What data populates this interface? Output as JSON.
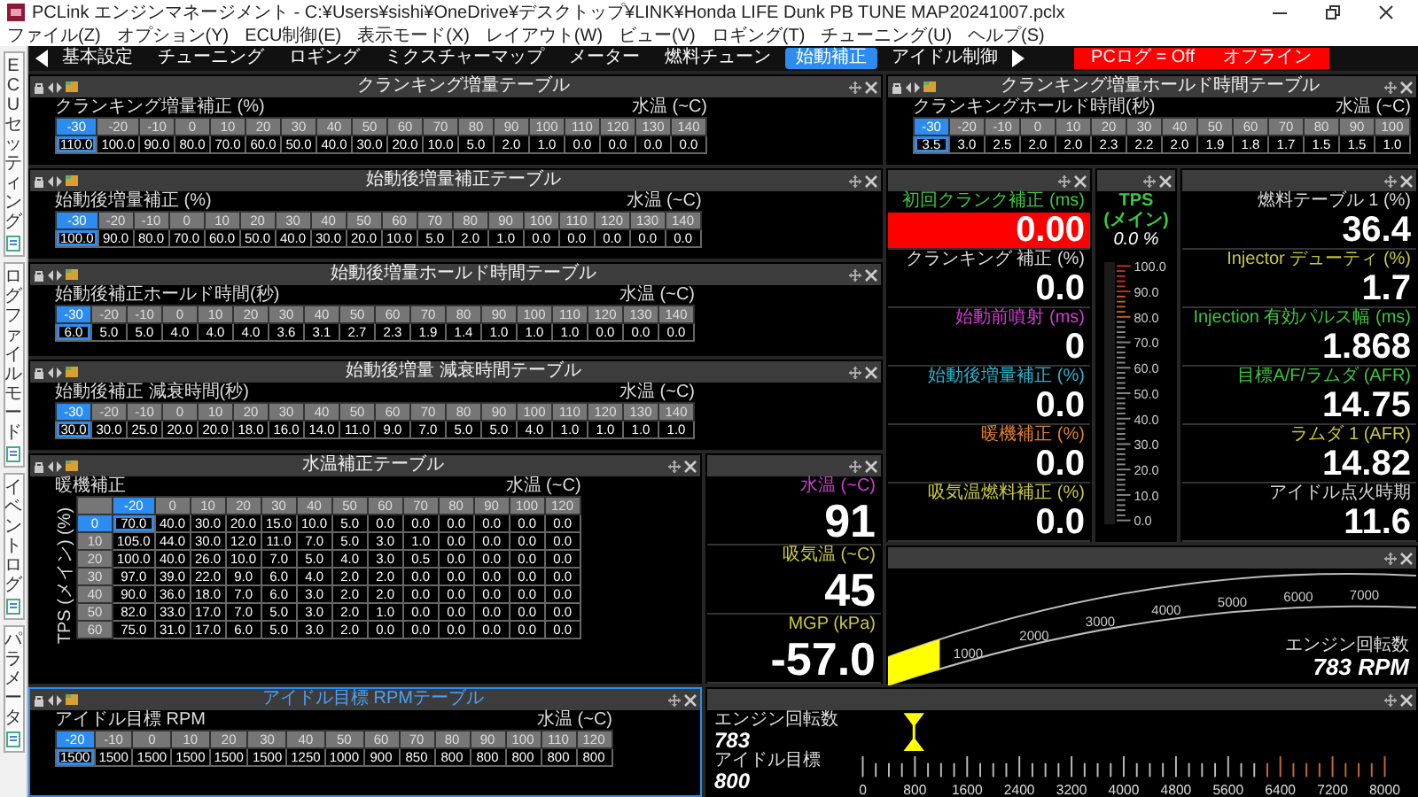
{
  "window": {
    "title": "PCLink エンジンマネージメント - C:¥Users¥sishi¥OneDrive¥デスクトップ¥LINK¥Honda LIFE Dunk PB TUNE MAP20241007.pclx"
  },
  "menu": [
    "ファイル(Z)",
    "オプション(Y)",
    "ECU制御(E)",
    "表示モード(X)",
    "レイアウト(W)",
    "ビュー(V)",
    "ロギング(T)",
    "チューニング(U)",
    "ヘルプ(S)"
  ],
  "sidebar": {
    "items": [
      {
        "label": "ECUセッティング"
      },
      {
        "label": "ログファイルモード"
      },
      {
        "label": "イベントログ"
      },
      {
        "label": "パラメータ"
      }
    ]
  },
  "tabs": [
    {
      "label": "基本設定",
      "selected": false
    },
    {
      "label": "チューニング",
      "selected": false
    },
    {
      "label": "ロギング",
      "selected": false
    },
    {
      "label": "ミクスチャーマップ",
      "selected": false
    },
    {
      "label": "メーター",
      "selected": false
    },
    {
      "label": "燃料チューン",
      "selected": false
    },
    {
      "label": "始動補正",
      "selected": true
    },
    {
      "label": "アイドル制御",
      "selected": false
    }
  ],
  "status": [
    "PCログ = Off",
    "オフライン"
  ],
  "tables": [
    {
      "kind": "row",
      "title": "クランキング増量テーブル",
      "focused": false,
      "axis_label": "クランキング増量補正 (%)",
      "unit": "水温 (~C)",
      "columns": [
        {
          "label": "-30",
          "selected": true
        },
        {
          "label": "-20",
          "selected": false
        },
        {
          "label": "-10",
          "selected": false
        },
        {
          "label": "0",
          "selected": false
        },
        {
          "label": "10",
          "selected": false
        },
        {
          "label": "20",
          "selected": false
        },
        {
          "label": "30",
          "selected": false
        },
        {
          "label": "40",
          "selected": false
        },
        {
          "label": "50",
          "selected": false
        },
        {
          "label": "60",
          "selected": false
        },
        {
          "label": "70",
          "selected": false
        },
        {
          "label": "80",
          "selected": false
        },
        {
          "label": "90",
          "selected": false
        },
        {
          "label": "100",
          "selected": false
        },
        {
          "label": "110",
          "selected": false
        },
        {
          "label": "120",
          "selected": false
        },
        {
          "label": "130",
          "selected": false
        },
        {
          "label": "140",
          "selected": false
        }
      ],
      "values": [
        "110.0",
        "100.0",
        "90.0",
        "80.0",
        "70.0",
        "60.0",
        "50.0",
        "40.0",
        "30.0",
        "20.0",
        "10.0",
        "5.0",
        "2.0",
        "1.0",
        "0.0",
        "0.0",
        "0.0",
        "0.0"
      ]
    },
    {
      "kind": "row",
      "title": "クランキング増量ホールド時間テーブル",
      "focused": false,
      "axis_label": "クランキングホールド時間(秒)",
      "unit": "水温 (~C)",
      "columns": [
        {
          "label": "-30",
          "selected": true
        },
        {
          "label": "-20",
          "selected": false
        },
        {
          "label": "-10",
          "selected": false
        },
        {
          "label": "0",
          "selected": false
        },
        {
          "label": "10",
          "selected": false
        },
        {
          "label": "20",
          "selected": false
        },
        {
          "label": "30",
          "selected": false
        },
        {
          "label": "40",
          "selected": false
        },
        {
          "label": "50",
          "selected": false
        },
        {
          "label": "60",
          "selected": false
        },
        {
          "label": "70",
          "selected": false
        },
        {
          "label": "80",
          "selected": false
        },
        {
          "label": "90",
          "selected": false
        },
        {
          "label": "100",
          "selected": false
        }
      ],
      "values": [
        "3.5",
        "3.0",
        "2.5",
        "2.0",
        "2.0",
        "2.3",
        "2.2",
        "2.0",
        "1.9",
        "1.8",
        "1.7",
        "1.5",
        "1.5",
        "1.0"
      ]
    },
    {
      "kind": "row",
      "title": "始動後増量補正テーブル",
      "focused": false,
      "axis_label": "始動後増量補正 (%)",
      "unit": "水温 (~C)",
      "columns": [
        {
          "label": "-30",
          "selected": true
        },
        {
          "label": "-20",
          "selected": false
        },
        {
          "label": "-10",
          "selected": false
        },
        {
          "label": "0",
          "selected": false
        },
        {
          "label": "10",
          "selected": false
        },
        {
          "label": "20",
          "selected": false
        },
        {
          "label": "30",
          "selected": false
        },
        {
          "label": "40",
          "selected": false
        },
        {
          "label": "50",
          "selected": false
        },
        {
          "label": "60",
          "selected": false
        },
        {
          "label": "70",
          "selected": false
        },
        {
          "label": "80",
          "selected": false
        },
        {
          "label": "90",
          "selected": false
        },
        {
          "label": "100",
          "selected": false
        },
        {
          "label": "110",
          "selected": false
        },
        {
          "label": "120",
          "selected": false
        },
        {
          "label": "130",
          "selected": false
        },
        {
          "label": "140",
          "selected": false
        }
      ],
      "values": [
        "100.0",
        "90.0",
        "80.0",
        "70.0",
        "60.0",
        "50.0",
        "40.0",
        "30.0",
        "20.0",
        "10.0",
        "5.0",
        "2.0",
        "1.0",
        "0.0",
        "0.0",
        "0.0",
        "0.0",
        "0.0"
      ]
    },
    {
      "kind": "row",
      "title": "始動後増量ホールド時間テーブル",
      "focused": false,
      "axis_label": "始動後補正ホールド時間(秒)",
      "unit": "水温 (~C)",
      "columns": [
        {
          "label": "-30",
          "selected": true
        },
        {
          "label": "-20",
          "selected": false
        },
        {
          "label": "-10",
          "selected": false
        },
        {
          "label": "0",
          "selected": false
        },
        {
          "label": "10",
          "selected": false
        },
        {
          "label": "20",
          "selected": false
        },
        {
          "label": "30",
          "selected": false
        },
        {
          "label": "40",
          "selected": false
        },
        {
          "label": "50",
          "selected": false
        },
        {
          "label": "60",
          "selected": false
        },
        {
          "label": "70",
          "selected": false
        },
        {
          "label": "80",
          "selected": false
        },
        {
          "label": "90",
          "selected": false
        },
        {
          "label": "100",
          "selected": false
        },
        {
          "label": "110",
          "selected": false
        },
        {
          "label": "120",
          "selected": false
        },
        {
          "label": "130",
          "selected": false
        },
        {
          "label": "140",
          "selected": false
        }
      ],
      "values": [
        "6.0",
        "5.0",
        "5.0",
        "4.0",
        "4.0",
        "4.0",
        "3.6",
        "3.1",
        "2.7",
        "2.3",
        "1.9",
        "1.4",
        "1.0",
        "1.0",
        "1.0",
        "0.0",
        "0.0",
        "0.0"
      ]
    },
    {
      "kind": "row",
      "title": "始動後増量 減衰時間テーブル",
      "focused": false,
      "axis_label": "始動後補正 減衰時間(秒)",
      "unit": "水温 (~C)",
      "columns": [
        {
          "label": "-30",
          "selected": true
        },
        {
          "label": "-20",
          "selected": false
        },
        {
          "label": "-10",
          "selected": false
        },
        {
          "label": "0",
          "selected": false
        },
        {
          "label": "10",
          "selected": false
        },
        {
          "label": "20",
          "selected": false
        },
        {
          "label": "30",
          "selected": false
        },
        {
          "label": "40",
          "selected": false
        },
        {
          "label": "50",
          "selected": false
        },
        {
          "label": "60",
          "selected": false
        },
        {
          "label": "70",
          "selected": false
        },
        {
          "label": "80",
          "selected": false
        },
        {
          "label": "90",
          "selected": false
        },
        {
          "label": "100",
          "selected": false
        },
        {
          "label": "110",
          "selected": false
        },
        {
          "label": "120",
          "selected": false
        },
        {
          "label": "130",
          "selected": false
        },
        {
          "label": "140",
          "selected": false
        }
      ],
      "values": [
        "30.0",
        "30.0",
        "25.0",
        "20.0",
        "20.0",
        "18.0",
        "16.0",
        "14.0",
        "11.0",
        "9.0",
        "7.0",
        "5.0",
        "5.0",
        "4.0",
        "1.0",
        "1.0",
        "1.0",
        "1.0"
      ]
    },
    {
      "kind": "grid",
      "title": "水温補正テーブル",
      "focused": false,
      "axis_label": "暖機補正",
      "unit": "水温 (~C)",
      "row_axis_label": "TPS (メイン) (%)",
      "columns": [
        {
          "label": "-20",
          "selected": true
        },
        {
          "label": "0",
          "selected": false
        },
        {
          "label": "10",
          "selected": false
        },
        {
          "label": "20",
          "selected": false
        },
        {
          "label": "30",
          "selected": false
        },
        {
          "label": "40",
          "selected": false
        },
        {
          "label": "50",
          "selected": false
        },
        {
          "label": "60",
          "selected": false
        },
        {
          "label": "70",
          "selected": false
        },
        {
          "label": "80",
          "selected": false
        },
        {
          "label": "90",
          "selected": false
        },
        {
          "label": "100",
          "selected": false
        },
        {
          "label": "120",
          "selected": false
        }
      ],
      "rows": [
        {
          "label": "0",
          "selected": true,
          "values": [
            "70.0",
            "40.0",
            "30.0",
            "20.0",
            "15.0",
            "10.0",
            "5.0",
            "0.0",
            "0.0",
            "0.0",
            "0.0",
            "0.0",
            "0.0"
          ]
        },
        {
          "label": "10",
          "selected": false,
          "values": [
            "105.0",
            "44.0",
            "30.0",
            "12.0",
            "11.0",
            "7.0",
            "5.0",
            "3.0",
            "1.0",
            "0.0",
            "0.0",
            "0.0",
            "0.0"
          ]
        },
        {
          "label": "20",
          "selected": false,
          "values": [
            "100.0",
            "40.0",
            "26.0",
            "10.0",
            "7.0",
            "5.0",
            "4.0",
            "3.0",
            "0.5",
            "0.0",
            "0.0",
            "0.0",
            "0.0"
          ]
        },
        {
          "label": "30",
          "selected": false,
          "values": [
            "97.0",
            "39.0",
            "22.0",
            "9.0",
            "6.0",
            "4.0",
            "2.0",
            "2.0",
            "0.0",
            "0.0",
            "0.0",
            "0.0",
            "0.0"
          ]
        },
        {
          "label": "40",
          "selected": false,
          "values": [
            "90.0",
            "36.0",
            "18.0",
            "7.0",
            "6.0",
            "3.0",
            "2.0",
            "2.0",
            "0.0",
            "0.0",
            "0.0",
            "0.0",
            "0.0"
          ]
        },
        {
          "label": "50",
          "selected": false,
          "values": [
            "82.0",
            "33.0",
            "17.0",
            "7.0",
            "5.0",
            "3.0",
            "2.0",
            "1.0",
            "0.0",
            "0.0",
            "0.0",
            "0.0",
            "0.0"
          ]
        },
        {
          "label": "60",
          "selected": false,
          "values": [
            "75.0",
            "31.0",
            "17.0",
            "6.0",
            "5.0",
            "3.0",
            "2.0",
            "0.0",
            "0.0",
            "0.0",
            "0.0",
            "0.0",
            "0.0"
          ]
        }
      ]
    },
    {
      "kind": "row",
      "title": "アイドル目標 RPMテーブル",
      "focused": true,
      "axis_label": "アイドル目標 RPM",
      "unit": "水温 (~C)",
      "columns": [
        {
          "label": "-20",
          "selected": true
        },
        {
          "label": "-10",
          "selected": false
        },
        {
          "label": "0",
          "selected": false
        },
        {
          "label": "10",
          "selected": false
        },
        {
          "label": "20",
          "selected": false
        },
        {
          "label": "30",
          "selected": false
        },
        {
          "label": "40",
          "selected": false
        },
        {
          "label": "50",
          "selected": false
        },
        {
          "label": "60",
          "selected": false
        },
        {
          "label": "70",
          "selected": false
        },
        {
          "label": "80",
          "selected": false
        },
        {
          "label": "90",
          "selected": false
        },
        {
          "label": "100",
          "selected": false
        },
        {
          "label": "110",
          "selected": false
        },
        {
          "label": "120",
          "selected": false
        }
      ],
      "values": [
        "1500",
        "1500",
        "1500",
        "1500",
        "1500",
        "1500",
        "1250",
        "1000",
        "900",
        "850",
        "800",
        "800",
        "800",
        "800",
        "800"
      ]
    }
  ],
  "readouts_left": [
    {
      "label": "初回クランク補正 (ms)",
      "value": "0.00",
      "color": "#3cc83c",
      "alarm": true
    },
    {
      "label": "クランキング 補正 (%)",
      "value": "0.0",
      "color": "#d8d8d8",
      "alarm": false
    },
    {
      "label": "始動前噴射 (ms)",
      "value": "0",
      "color": "#d23cd2",
      "alarm": false
    },
    {
      "label": "始動後増量補正 (%)",
      "value": "0.0",
      "color": "#28b4d2",
      "alarm": false
    },
    {
      "label": "暖機補正 (%)",
      "value": "0.0",
      "color": "#e0802a",
      "alarm": false
    },
    {
      "label": "吸気温燃料補正 (%)",
      "value": "0.0",
      "color": "#c8c83c",
      "alarm": false
    }
  ],
  "tps": {
    "label": "TPS (メイン)",
    "reading": "0.0 %",
    "scale": [
      "100.0",
      "90.0",
      "80.0",
      "70.0",
      "60.0",
      "50.0",
      "40.0",
      "30.0",
      "20.0",
      "10.0",
      "0.0"
    ],
    "level": 0
  },
  "readouts_right": [
    {
      "label": "燃料テーブル 1 (%)",
      "value": "36.4",
      "color": "#d8d8d8",
      "alarm": false
    },
    {
      "label": "Injector デューティ (%)",
      "value": "1.7",
      "color": "#c8c83c",
      "alarm": false
    },
    {
      "label": "Injection 有効パルス幅 (ms)",
      "value": "1.868",
      "color": "#3cc83c",
      "alarm": false
    },
    {
      "label": "目標A/F/ラムダ (AFR)",
      "value": "14.75",
      "color": "#3cc83c",
      "alarm": false
    },
    {
      "label": "ラムダ 1 (AFR)",
      "value": "14.82",
      "color": "#c8c83c",
      "alarm": false
    },
    {
      "label": "アイドル点火時期",
      "value": "11.6",
      "color": "#d8d8d8",
      "alarm": false
    }
  ],
  "temps": [
    {
      "label": "水温 (~C)",
      "value": "91",
      "color": "#d23cd2",
      "alarm": false
    },
    {
      "label": "吸気温 (~C)",
      "value": "45",
      "color": "#c8c83c",
      "alarm": false
    },
    {
      "label": "MGP (kPa)",
      "value": "-57.0",
      "color": "#c8c83c",
      "alarm": false
    }
  ],
  "rpm_arc": {
    "ticks": [
      "1000",
      "2000",
      "3000",
      "4000",
      "5000",
      "6000",
      "7000"
    ],
    "label": "エンジン回転数",
    "reading": "783 RPM",
    "level": 0.098
  },
  "rpm_bar": {
    "rpm_label": "エンジン回転数",
    "rpm": "783",
    "target_label": "アイドル目標",
    "target": "800",
    "scale": [
      "0",
      "800",
      "1600",
      "2400",
      "3200",
      "4000",
      "4800",
      "5600",
      "6400",
      "7200",
      "8000"
    ],
    "level": 0.098
  }
}
